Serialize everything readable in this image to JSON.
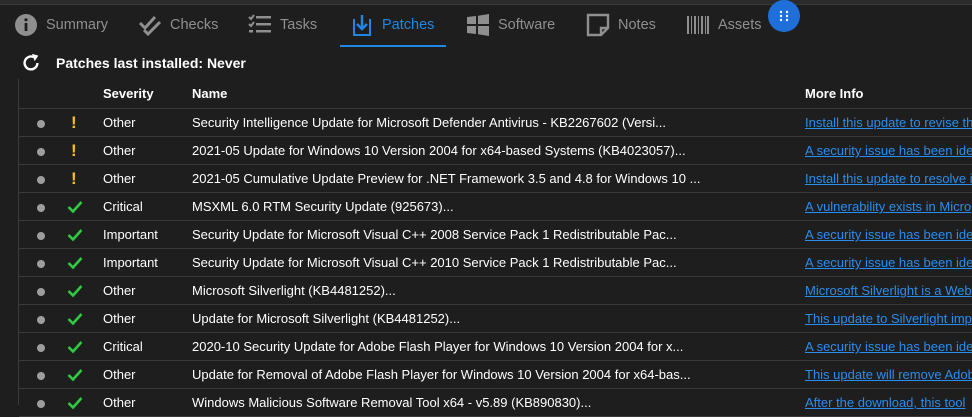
{
  "tabs": [
    {
      "label": "Summary",
      "icon": "info-icon"
    },
    {
      "label": "Checks",
      "icon": "checks-icon"
    },
    {
      "label": "Tasks",
      "icon": "tasks-icon"
    },
    {
      "label": "Patches",
      "icon": "patches-icon",
      "active": true
    },
    {
      "label": "Software",
      "icon": "windows-icon"
    },
    {
      "label": "Notes",
      "icon": "notes-icon"
    },
    {
      "label": "Assets",
      "icon": "barcode-icon"
    }
  ],
  "header": {
    "title": "Patches last installed: Never"
  },
  "table": {
    "columns": [
      "",
      "",
      "Severity",
      "Name",
      "More Info"
    ],
    "rows": [
      {
        "status": "warning",
        "severity": "Other",
        "name": "Security Intelligence Update for Microsoft Defender Antivirus - KB2267602 (Versi...",
        "info": "Install this update to revise the"
      },
      {
        "status": "warning",
        "severity": "Other",
        "name": "2021-05 Update for Windows 10 Version 2004 for x64-based Systems (KB4023057)...",
        "info": "A security issue has been ide"
      },
      {
        "status": "warning",
        "severity": "Other",
        "name": "2021-05 Cumulative Update Preview for .NET Framework 3.5 and 4.8 for Windows 10 ...",
        "info": "Install this update to resolve i"
      },
      {
        "status": "ok",
        "severity": "Critical",
        "name": "MSXML 6.0 RTM Security Update (925673)...",
        "info": "A vulnerability exists in Micro"
      },
      {
        "status": "ok",
        "severity": "Important",
        "name": "Security Update for Microsoft Visual C++ 2008 Service Pack 1 Redistributable Pac...",
        "info": "A security issue has been ide"
      },
      {
        "status": "ok",
        "severity": "Important",
        "name": "Security Update for Microsoft Visual C++ 2010 Service Pack 1 Redistributable Pac...",
        "info": "A security issue has been ide"
      },
      {
        "status": "ok",
        "severity": "Other",
        "name": "Microsoft Silverlight (KB4481252)...",
        "info": "Microsoft Silverlight is a Web"
      },
      {
        "status": "ok",
        "severity": "Other",
        "name": "Update for Microsoft Silverlight (KB4481252)...",
        "info": "This update to Silverlight imp"
      },
      {
        "status": "ok",
        "severity": "Critical",
        "name": "2020-10 Security Update for Adobe Flash Player for Windows 10 Version 2004 for x...",
        "info": "A security issue has been ide"
      },
      {
        "status": "ok",
        "severity": "Other",
        "name": "Update for Removal of Adobe Flash Player for Windows 10 Version 2004 for x64-bas...",
        "info": "This update will remove Adob"
      },
      {
        "status": "ok",
        "severity": "Other",
        "name": "Windows Malicious Software Removal Tool x64 - v5.89 (KB890830)...",
        "info": "After the download, this tool"
      }
    ]
  },
  "colors": {
    "accent": "#1e88e5",
    "warning": "#ffc107",
    "ok": "#2ecc40",
    "link": "#2a8df0"
  }
}
